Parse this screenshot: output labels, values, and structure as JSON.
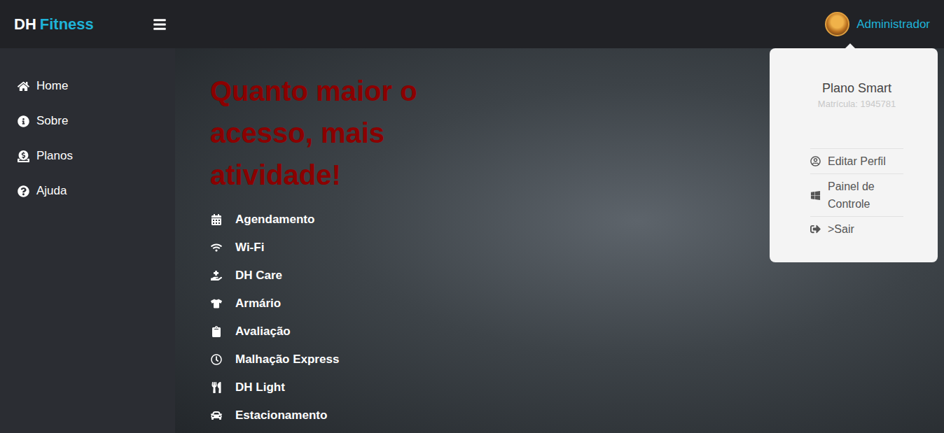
{
  "brand": {
    "prefix": "DH",
    "name": "Fitness"
  },
  "user": {
    "name": "Administrador"
  },
  "sidebar": {
    "items": [
      "Home",
      "Sobre",
      "Planos",
      "Ajuda"
    ]
  },
  "hero": {
    "title": "Quanto maior o acesso, mais atividade!",
    "features": [
      "Agendamento",
      "Wi-Fi",
      "DH Care",
      "Armário",
      "Avaliação",
      "Malhação Express",
      "DH Light",
      "Estacionamento"
    ]
  },
  "profile_menu": {
    "open": true,
    "plan": "Plano Smart",
    "registration": "Matrícula: 1945781",
    "items": [
      "Editar Perfil",
      "Painel de Controle",
      ">Sair"
    ]
  }
}
